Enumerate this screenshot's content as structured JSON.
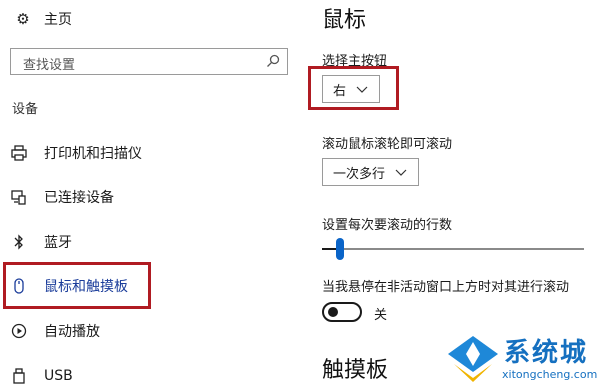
{
  "sidebar": {
    "home_label": "主页",
    "search_placeholder": "查找设置",
    "section_title": "设备",
    "items": [
      {
        "label": "打印机和扫描仪",
        "icon": "printer-icon"
      },
      {
        "label": "已连接设备",
        "icon": "connected-devices-icon"
      },
      {
        "label": "蓝牙",
        "icon": "bluetooth-icon"
      },
      {
        "label": "鼠标和触摸板",
        "icon": "mouse-icon",
        "active": true
      },
      {
        "label": "自动播放",
        "icon": "autoplay-icon"
      },
      {
        "label": "USB",
        "icon": "usb-icon"
      }
    ]
  },
  "main": {
    "title": "鼠标",
    "primary_button_label": "选择主按钮",
    "primary_button_value": "右",
    "scroll_label": "滚动鼠标滚轮即可滚动",
    "scroll_value": "一次多行",
    "lines_label": "设置每次要滚动的行数",
    "lines_slider_fraction": 0.07,
    "inactive_scroll_label": "当我悬停在非活动窗口上方时对其进行滚动",
    "inactive_scroll_state": "关",
    "touchpad_title": "触摸板"
  },
  "watermark": {
    "brand": "系统城",
    "url": "xitongcheng.com"
  },
  "colors": {
    "highlight_border": "#b01b22",
    "accent": "#0a64c8",
    "active_text": "#1a3c9a"
  }
}
